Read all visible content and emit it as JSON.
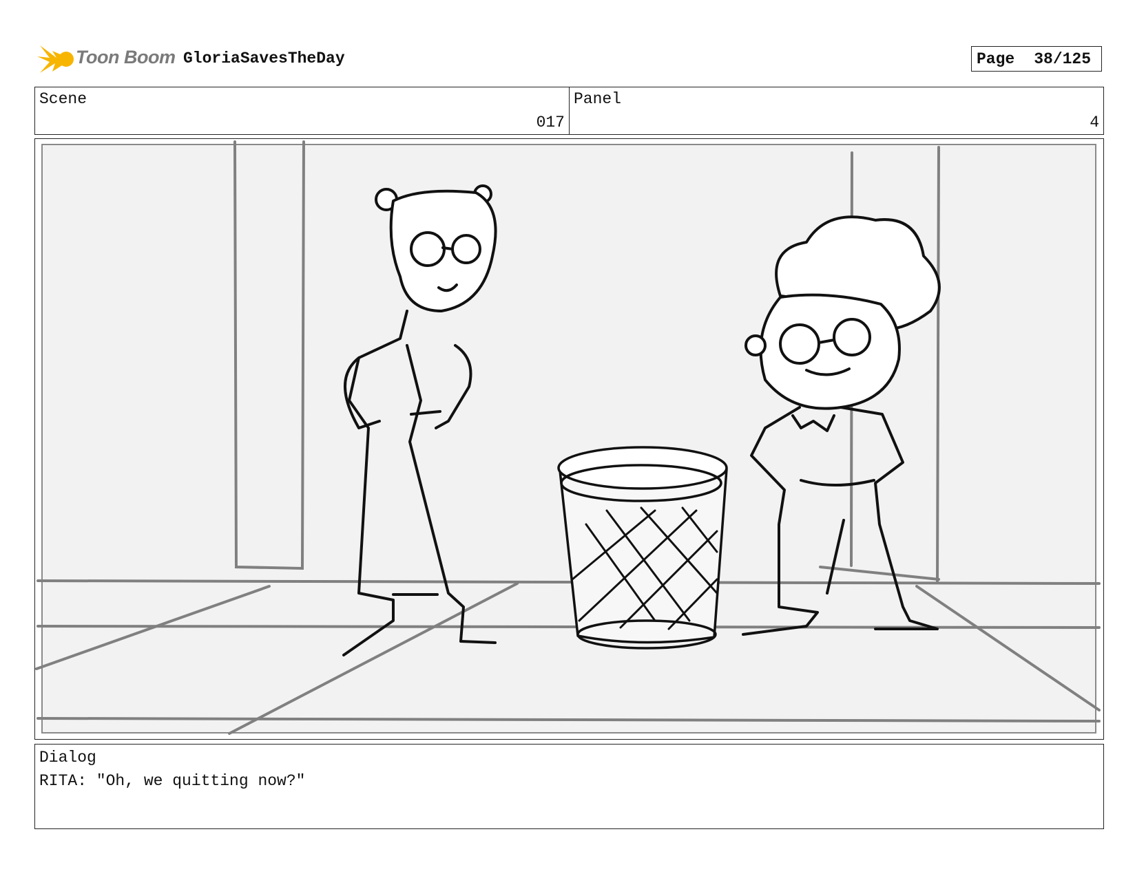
{
  "header": {
    "brand": "Toon Boom",
    "project_title": "GloriaSavesTheDay",
    "page_label": "Page",
    "page_number": "38/125"
  },
  "scene": {
    "label": "Scene",
    "value": "017"
  },
  "panel": {
    "label": "Panel",
    "value": "4"
  },
  "dialog": {
    "label": "Dialog",
    "text": "RITA: \"Oh, we quitting now?\""
  },
  "colors": {
    "logo_flame": "#f7b500",
    "frame_background": "#f2f2f2",
    "guide_lines": "#808080",
    "ink": "#111111"
  }
}
